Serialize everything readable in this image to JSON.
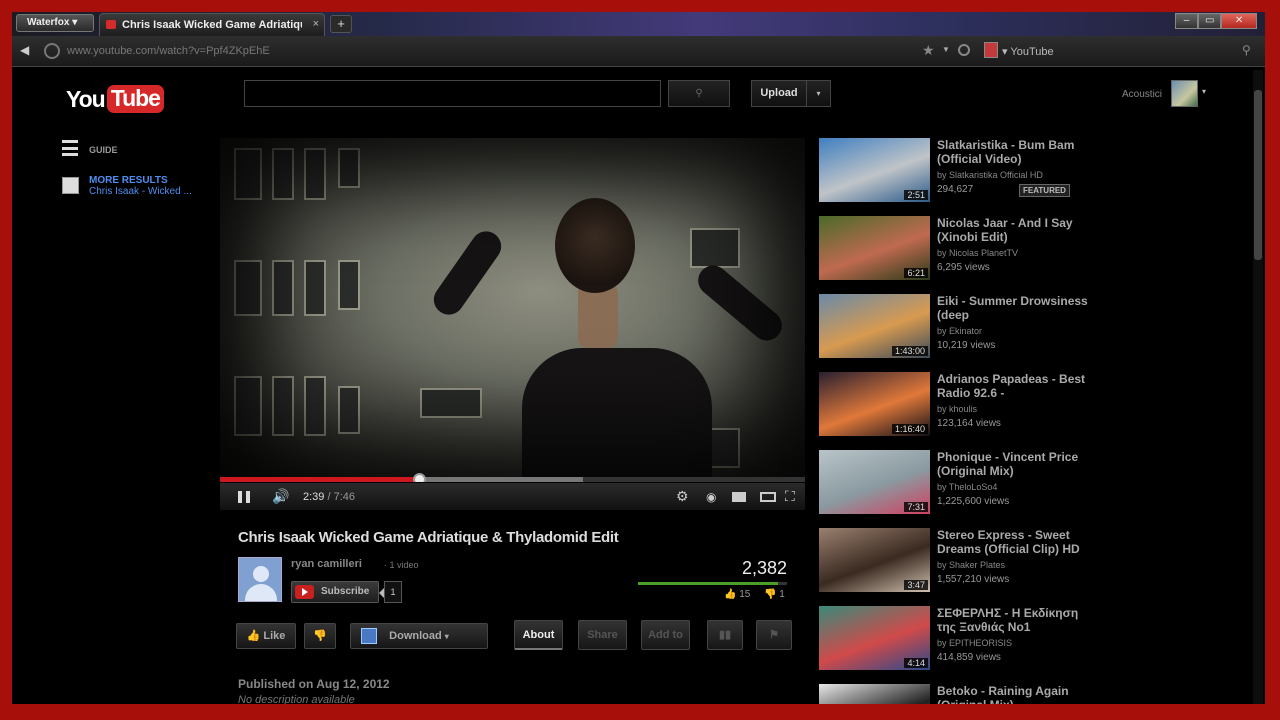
{
  "browser": {
    "app_button": "Waterfox ▾",
    "tab_title": "Chris Isaak Wicked Game Adriatique ...",
    "tab_close": "×",
    "new_tab": "+",
    "back_icon": "◀",
    "url": "www.youtube.com/watch?v=Ppf4ZKpEhE",
    "search_engine_label": "▾ YouTube",
    "window_controls": [
      "–",
      "▭",
      "✕"
    ]
  },
  "header": {
    "logo_you": "You",
    "logo_tube": "Tube",
    "search_placeholder": "",
    "upload_label": "Upload",
    "upload_arrow": "▾",
    "user_name": "Acoustici",
    "user_arrow": "▾"
  },
  "guide": {
    "guide_label": "GUIDE",
    "more_results_label": "MORE RESULTS",
    "more_results_query": "Chris Isaak - Wicked ..."
  },
  "player": {
    "current_time": "2:39",
    "duration": "/ 7:46",
    "progress_fraction": 0.341,
    "buffered_fraction": 0.62
  },
  "video": {
    "title": "Chris Isaak Wicked Game Adriatique &  Thyladomid Edit",
    "channel_name": "ryan camilleri",
    "channel_video_count": "· 1 video",
    "subscribe_label": "Subscribe",
    "subscriber_count": "1",
    "view_count": "2,382",
    "likes": "15",
    "dislikes": "1",
    "like_fraction": 0.94,
    "like_label": "Like",
    "download_label": "Download",
    "tabs": [
      "About",
      "Share",
      "Add to"
    ],
    "published": "Published on Aug 12, 2012",
    "description": "No description available"
  },
  "suggestions": [
    {
      "title": "Slatkaristika - Bum Bam (Official Video)",
      "by": "by Slatkaristika Official HD",
      "views": "294,627",
      "duration": "2:51",
      "badge": "FEATURED",
      "colors": [
        "#3f7fc0",
        "#c0c4c8",
        "#2a5a8a"
      ]
    },
    {
      "title": "Nicolas Jaar - And I Say (Xinobi Edit)",
      "by": "by Nicolas PlanetTV",
      "views": "6,295 views",
      "duration": "6:21",
      "colors": [
        "#4a6a2a",
        "#c06a50",
        "#2a3a18"
      ]
    },
    {
      "title": "Eiki - Summer Drowsiness (deep",
      "by": "by Ekinator",
      "views": "10,219 views",
      "duration": "1:43:00",
      "colors": [
        "#6a8aa8",
        "#d89a50",
        "#3a4a5a"
      ]
    },
    {
      "title": "Adrianos Papadeas - Best Radio 92.6 -",
      "by": "by khoulis",
      "views": "123,164 views",
      "duration": "1:16:40",
      "colors": [
        "#2a2030",
        "#e0783a",
        "#101018"
      ]
    },
    {
      "title": "Phonique - Vincent Price (Original Mix)",
      "by": "by TheloLoSo4",
      "views": "1,225,600 views",
      "duration": "7:31",
      "colors": [
        "#b8c4c8",
        "#8a9aa0",
        "#d04060"
      ]
    },
    {
      "title": "Stereo Express - Sweet Dreams (Official Clip) HD",
      "by": "by Shaker Plates",
      "views": "1,557,210 views",
      "duration": "3:47",
      "colors": [
        "#9a8070",
        "#3a2a20",
        "#d0c0b0"
      ]
    },
    {
      "title": "ΣΕΦΕΡΛΗΣ - Η Εκδίκηση της Ξανθιάς No1",
      "by": "by EPITHEORISIS",
      "views": "414,859 views",
      "duration": "4:14",
      "colors": [
        "#3a8a7a",
        "#d04a4a",
        "#2a4a8a"
      ]
    },
    {
      "title": "Betoko - Raining Again (Original Mix)",
      "by": "",
      "views": "",
      "duration": "",
      "colors": [
        "#e8e8e8",
        "#202020",
        "#f0f0f0"
      ]
    }
  ]
}
